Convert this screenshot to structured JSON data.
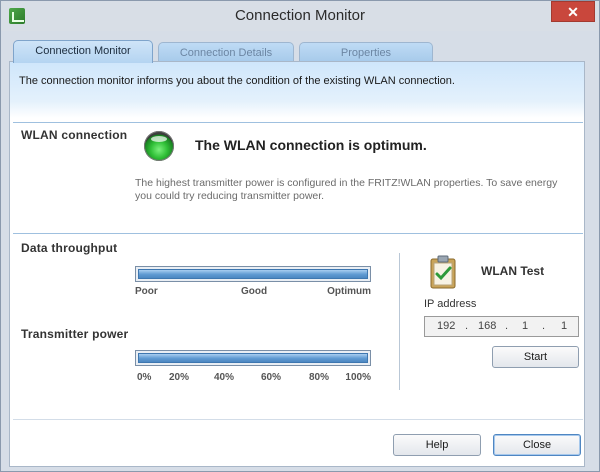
{
  "window": {
    "title": "Connection Monitor",
    "close_glyph": "✕"
  },
  "tabs": [
    {
      "label": "Connection Monitor",
      "active": true
    },
    {
      "label": "Connection Details",
      "active": false
    },
    {
      "label": "Properties",
      "active": false
    }
  ],
  "info": "The connection monitor informs you about the condition of the existing WLAN connection.",
  "wlan": {
    "section_label": "WLAN connection",
    "status": "The WLAN connection is optimum.",
    "description": "The highest transmitter power is configured in the FRITZ!WLAN properties. To save energy you could try reducing transmitter power."
  },
  "throughput": {
    "label": "Data throughput",
    "level": 1.0,
    "scale": [
      "Poor",
      "Good",
      "Optimum"
    ]
  },
  "transmitter": {
    "label": "Transmitter power",
    "level": 1.0,
    "scale": [
      "0%",
      "20%",
      "40%",
      "60%",
      "80%",
      "100%"
    ]
  },
  "wlan_test": {
    "label": "WLAN Test",
    "ip_label": "IP address",
    "ip": [
      "192",
      "168",
      "1",
      "1"
    ],
    "ip_sep": ".",
    "start_label": "Start"
  },
  "buttons": {
    "help": "Help",
    "close": "Close"
  },
  "colors": {
    "led": "#2fbf36",
    "bar_fill": "#5f9ad2"
  }
}
